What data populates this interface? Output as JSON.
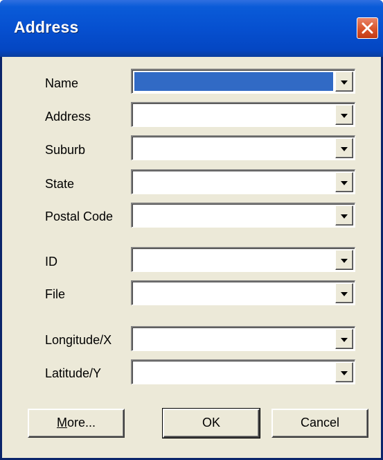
{
  "dialog": {
    "title": "Address"
  },
  "fields": [
    {
      "label": "Name",
      "value": "",
      "selected": true
    },
    {
      "label": "Address",
      "value": ""
    },
    {
      "label": "Suburb",
      "value": ""
    },
    {
      "label": "State",
      "value": ""
    },
    {
      "label": "Postal Code",
      "value": ""
    },
    {
      "label": "ID",
      "value": ""
    },
    {
      "label": "File",
      "value": ""
    },
    {
      "label": "Longitude/X",
      "value": ""
    },
    {
      "label": "Latitude/Y",
      "value": ""
    }
  ],
  "buttons": {
    "more_mnemonic": "M",
    "more_rest": "ore...",
    "ok": "OK",
    "cancel": "Cancel"
  },
  "colors": {
    "titlebar": "#0650d0",
    "close_button": "#d9542b",
    "dialog_bg": "#ece9d8",
    "selection": "#316ac5"
  },
  "icons": {
    "close": "close-icon",
    "dropdown": "chevron-down-icon"
  }
}
